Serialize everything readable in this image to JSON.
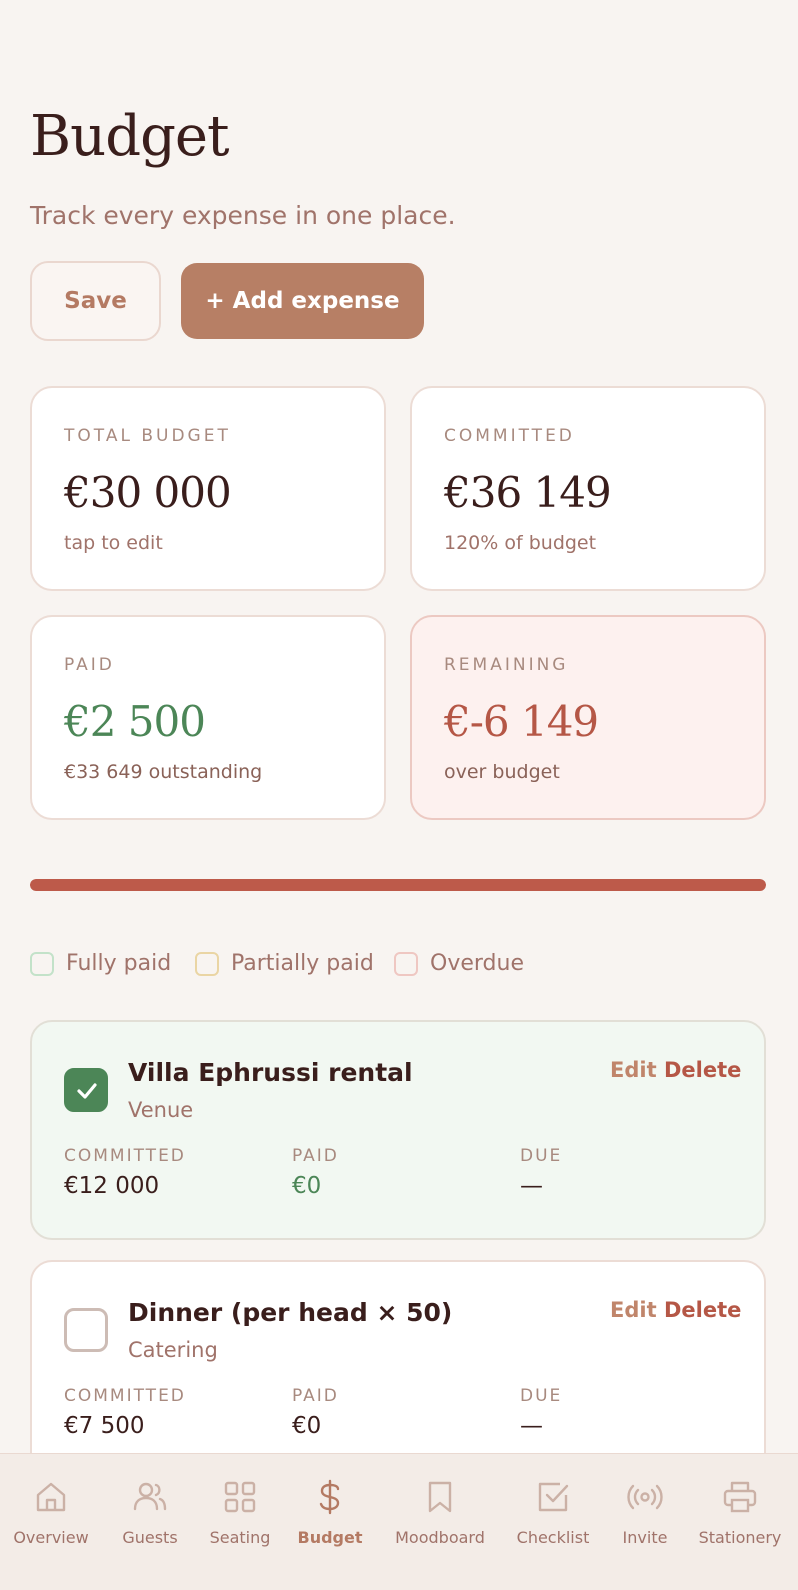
{
  "header": {
    "title": "Budget",
    "subtitle": "Track every expense in one place."
  },
  "toolbar": {
    "save_label": "Save",
    "add_label": "+ Add expense"
  },
  "summary": {
    "total": {
      "label": "TOTAL BUDGET",
      "value": "€30 000",
      "note": "tap to edit"
    },
    "committed": {
      "label": "COMMITTED",
      "value": "€36 149",
      "note": "120% of budget"
    },
    "paid": {
      "label": "PAID",
      "value": "€2 500",
      "note": "€33 649 outstanding"
    },
    "remaining": {
      "label": "REMAINING",
      "value": "€-6 149",
      "note": "over budget"
    }
  },
  "progress": {
    "fraction": 1.0,
    "color": "#bd5a4a"
  },
  "legend": [
    {
      "label": "Fully paid",
      "border": "#c3e2c9"
    },
    {
      "label": "Partially paid",
      "border": "#ead5a4"
    },
    {
      "label": "Overdue",
      "border": "#efc7c2"
    }
  ],
  "expenses": [
    {
      "name": "Villa Ephrussi rental",
      "category": "Venue",
      "checked": true,
      "edit_label": "Edit",
      "delete_label": "Delete",
      "committed_label": "COMMITTED",
      "committed": "€12 000",
      "paid_label": "PAID",
      "paid": "€0",
      "due_label": "DUE",
      "due": "—"
    },
    {
      "name": "Dinner (per head × 50)",
      "category": "Catering",
      "checked": false,
      "edit_label": "Edit",
      "delete_label": "Delete",
      "committed_label": "COMMITTED",
      "committed": "€7 500",
      "paid_label": "PAID",
      "paid": "€0",
      "due_label": "DUE",
      "due": "—"
    }
  ],
  "nav": {
    "items": [
      {
        "label": "Overview",
        "icon": "home-icon"
      },
      {
        "label": "Guests",
        "icon": "users-icon"
      },
      {
        "label": "Seating",
        "icon": "grid-icon"
      },
      {
        "label": "Budget",
        "icon": "dollar-icon",
        "active": true
      },
      {
        "label": "Moodboard",
        "icon": "bookmark-icon"
      },
      {
        "label": "Checklist",
        "icon": "checkbox-icon"
      },
      {
        "label": "Invite",
        "icon": "broadcast-icon"
      },
      {
        "label": "Stationery",
        "icon": "printer-icon"
      }
    ]
  },
  "colors": {
    "accent": "#b77f65",
    "positive": "#4c8657",
    "negative": "#b55746",
    "background": "#f8f4f1"
  }
}
